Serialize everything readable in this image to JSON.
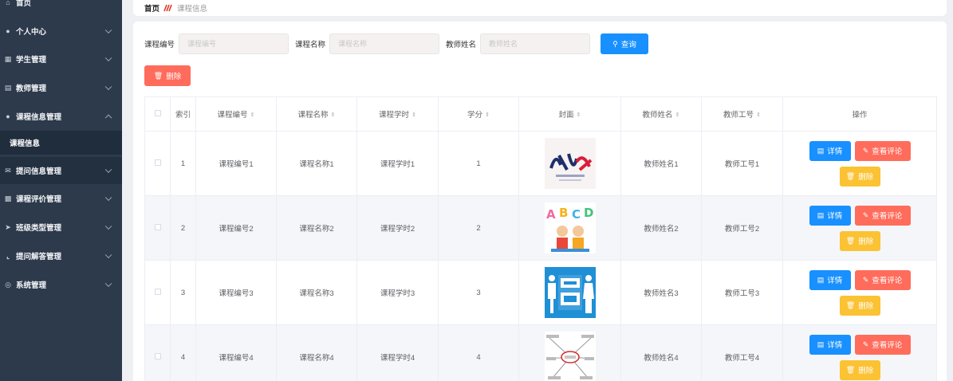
{
  "sidebar": {
    "items": [
      {
        "label": "首页",
        "icon": "home-icon"
      },
      {
        "label": "个人中心",
        "icon": "user-icon"
      },
      {
        "label": "学生管理",
        "icon": "student-icon"
      },
      {
        "label": "教师管理",
        "icon": "teacher-icon"
      },
      {
        "label": "课程信息管理",
        "icon": "user-icon"
      },
      {
        "label": "提问信息管理",
        "icon": "mail-icon"
      },
      {
        "label": "课程评价管理",
        "icon": "message-icon"
      },
      {
        "label": "班级类型管理",
        "icon": "send-icon"
      },
      {
        "label": "提问解答管理",
        "icon": "crop-icon"
      },
      {
        "label": "系统管理",
        "icon": "globe-icon"
      }
    ],
    "sub_item": "课程信息"
  },
  "breadcrumb": {
    "home": "首页",
    "current": "课程信息"
  },
  "search": {
    "code_label": "课程编号",
    "code_placeholder": "课程编号",
    "name_label": "课程名称",
    "name_placeholder": "课程名称",
    "teacher_label": "教师姓名",
    "teacher_placeholder": "教师姓名",
    "button": "查询"
  },
  "toolbar": {
    "delete_label": "删除"
  },
  "table": {
    "headers": {
      "index": "索引",
      "code": "课程编号",
      "name": "课程名称",
      "hours": "课程学时",
      "credit": "学分",
      "cover": "封面",
      "teacher_name": "教师姓名",
      "teacher_id": "教师工号",
      "ops": "操作"
    },
    "rows": [
      {
        "index": "1",
        "code": "课程编号1",
        "name": "课程名称1",
        "hours": "课程学时1",
        "credit": "1",
        "teacher_name": "教师姓名1",
        "teacher_id": "教师工号1"
      },
      {
        "index": "2",
        "code": "课程编号2",
        "name": "课程名称2",
        "hours": "课程学时2",
        "credit": "2",
        "teacher_name": "教师姓名2",
        "teacher_id": "教师工号2"
      },
      {
        "index": "3",
        "code": "课程编号3",
        "name": "课程名称3",
        "hours": "课程学时3",
        "credit": "3",
        "teacher_name": "教师姓名3",
        "teacher_id": "教师工号3"
      },
      {
        "index": "4",
        "code": "课程编号4",
        "name": "课程名称4",
        "hours": "课程学时4",
        "credit": "4",
        "teacher_name": "教师姓名4",
        "teacher_id": "教师工号4"
      }
    ],
    "actions": {
      "detail": "详情",
      "comments": "查看评论",
      "delete": "删除"
    }
  },
  "colors": {
    "sidebar_bg": "#2d3a4b",
    "primary": "#1890ff",
    "danger": "#ff6c5c",
    "warning": "#fbc234"
  }
}
